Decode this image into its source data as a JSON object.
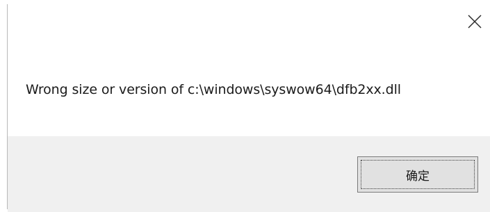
{
  "dialog": {
    "message": "Wrong size or version of c:\\windows\\syswow64\\dfb2xx.dll",
    "ok_label": "确定",
    "close_icon": "close-icon"
  },
  "colors": {
    "footer_background": "#f0f0f0",
    "button_background": "#e1e1e1",
    "button_border": "#7a7a7a",
    "text": "#1a1a1a"
  }
}
